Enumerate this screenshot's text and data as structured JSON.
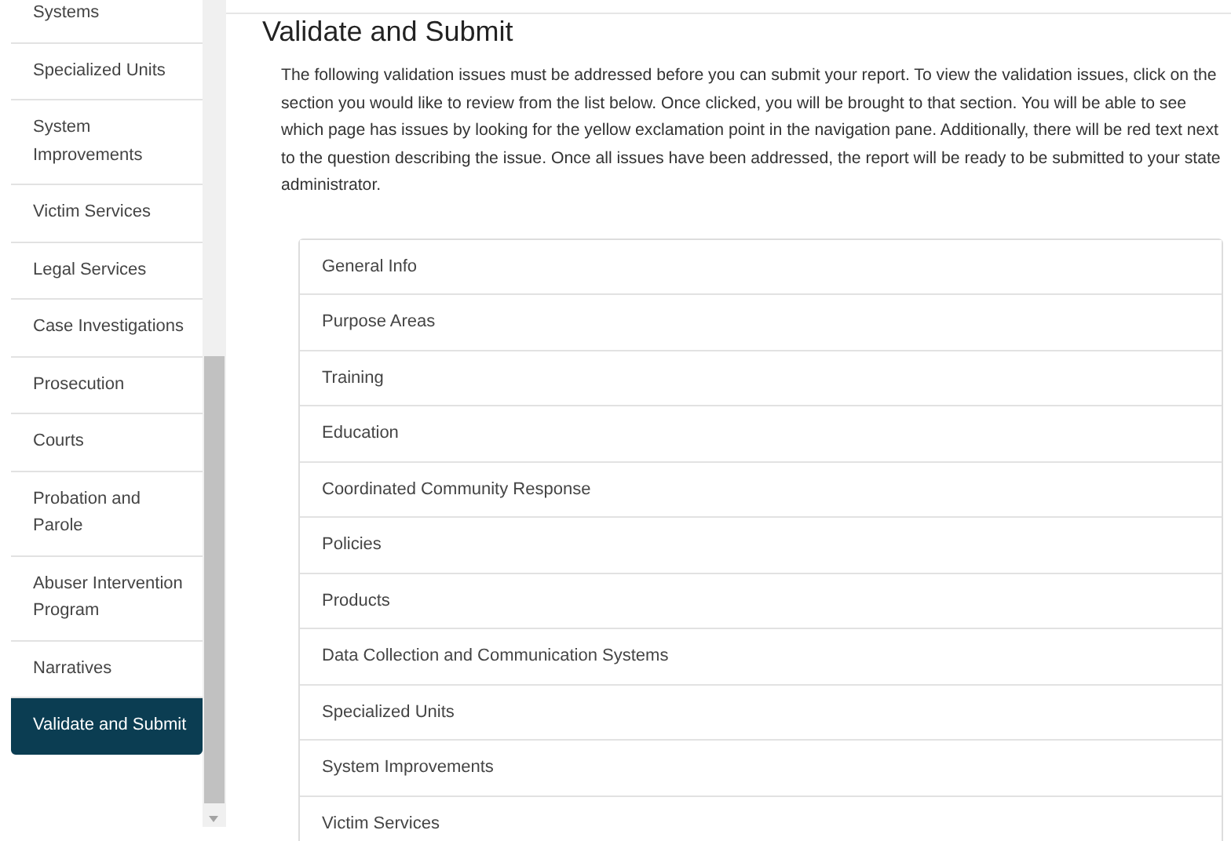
{
  "sidebar": {
    "items": [
      {
        "label": "Systems",
        "selected": false
      },
      {
        "label": "Specialized Units",
        "selected": false
      },
      {
        "label": "System Improvements",
        "selected": false
      },
      {
        "label": "Victim Services",
        "selected": false
      },
      {
        "label": "Legal Services",
        "selected": false
      },
      {
        "label": "Case Investigations",
        "selected": false
      },
      {
        "label": "Prosecution",
        "selected": false
      },
      {
        "label": "Courts",
        "selected": false
      },
      {
        "label": "Probation and Parole",
        "selected": false
      },
      {
        "label": "Abuser Intervention Program",
        "selected": false
      },
      {
        "label": "Narratives",
        "selected": false
      },
      {
        "label": "Validate and Submit",
        "selected": true
      }
    ]
  },
  "main": {
    "title": "Validate and Submit",
    "description": "The following validation issues must be addressed before you can submit your report. To view the validation issues, click on the section you would like to review from the list below. Once clicked, you will be brought to that section. You will be able to see which page has issues by looking for the yellow exclamation point in the navigation pane. Additionally, there will be red text next to the question describing the issue. Once all issues have been addressed, the report will be ready to be submitted to your state administrator.",
    "sections": [
      "General Info",
      "Purpose Areas",
      "Training",
      "Education",
      "Coordinated Community Response",
      "Policies",
      "Products",
      "Data Collection and Communication Systems",
      "Specialized Units",
      "System Improvements",
      "Victim Services"
    ]
  }
}
